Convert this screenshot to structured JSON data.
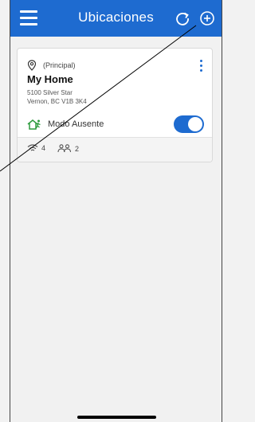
{
  "header": {
    "title": "Ubicaciones"
  },
  "location": {
    "tag": "(Principal)",
    "name": "My Home",
    "address_line1": "5100 Silver Star",
    "address_line2": "Vernon, BC V1B 3K4",
    "away_mode_label": "Modo Ausente",
    "away_mode_on": true,
    "device_count": "4",
    "user_count": "2"
  },
  "colors": {
    "accent": "#1e6bd0",
    "away_icon": "#2e9b3e"
  },
  "icons": [
    "menu-icon",
    "refresh-icon",
    "add-circle-icon",
    "location-pin-icon",
    "more-vert-icon",
    "away-mode-icon",
    "wifi-icon",
    "users-icon"
  ]
}
